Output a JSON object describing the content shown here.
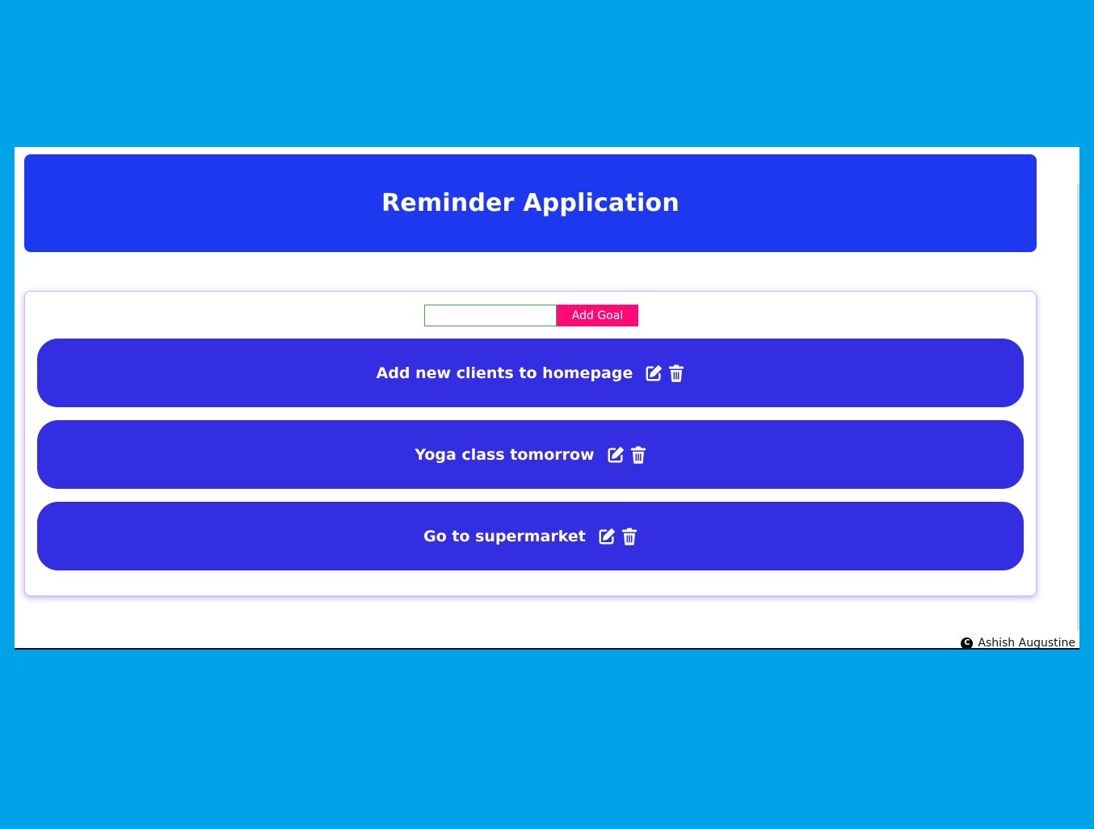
{
  "app": {
    "title": "Reminder Application"
  },
  "form": {
    "input_value": "",
    "input_placeholder": "",
    "add_button_label": "Add Goal"
  },
  "goals": [
    {
      "text": "Add new clients to homepage"
    },
    {
      "text": "Yoga class tomorrow"
    },
    {
      "text": "Go to supermarket"
    }
  ],
  "footer": {
    "copyright_symbol": "C",
    "author": "Ashish Augustine"
  },
  "colors": {
    "background": "#00a3e8",
    "header": "#1c39f0",
    "goal_item": "#342ee2",
    "add_button": "#ff0b77",
    "card_border": "#c8b8ff"
  },
  "icons": {
    "edit": "edit-icon",
    "delete": "trash-icon",
    "copyright": "copyright-icon"
  }
}
